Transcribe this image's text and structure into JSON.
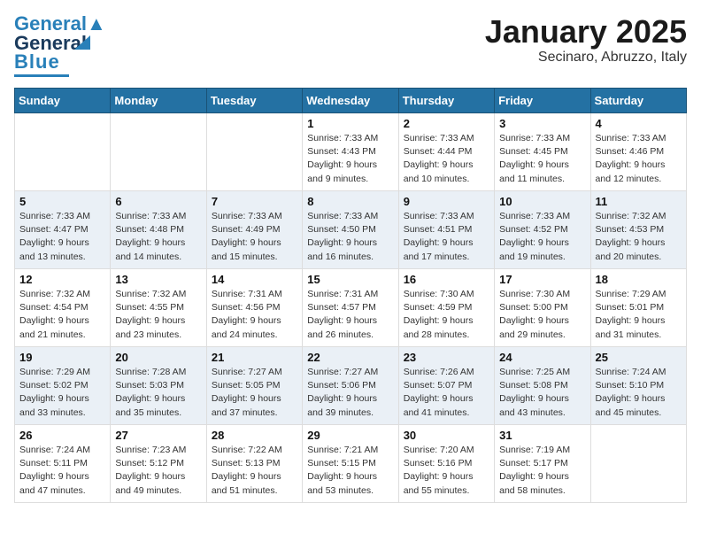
{
  "header": {
    "logo_line1": "General",
    "logo_line2": "Blue",
    "title": "January 2025",
    "subtitle": "Secinaro, Abruzzo, Italy"
  },
  "weekdays": [
    "Sunday",
    "Monday",
    "Tuesday",
    "Wednesday",
    "Thursday",
    "Friday",
    "Saturday"
  ],
  "weeks": [
    [
      {
        "day": "",
        "info": ""
      },
      {
        "day": "",
        "info": ""
      },
      {
        "day": "",
        "info": ""
      },
      {
        "day": "1",
        "info": "Sunrise: 7:33 AM\nSunset: 4:43 PM\nDaylight: 9 hours\nand 9 minutes."
      },
      {
        "day": "2",
        "info": "Sunrise: 7:33 AM\nSunset: 4:44 PM\nDaylight: 9 hours\nand 10 minutes."
      },
      {
        "day": "3",
        "info": "Sunrise: 7:33 AM\nSunset: 4:45 PM\nDaylight: 9 hours\nand 11 minutes."
      },
      {
        "day": "4",
        "info": "Sunrise: 7:33 AM\nSunset: 4:46 PM\nDaylight: 9 hours\nand 12 minutes."
      }
    ],
    [
      {
        "day": "5",
        "info": "Sunrise: 7:33 AM\nSunset: 4:47 PM\nDaylight: 9 hours\nand 13 minutes."
      },
      {
        "day": "6",
        "info": "Sunrise: 7:33 AM\nSunset: 4:48 PM\nDaylight: 9 hours\nand 14 minutes."
      },
      {
        "day": "7",
        "info": "Sunrise: 7:33 AM\nSunset: 4:49 PM\nDaylight: 9 hours\nand 15 minutes."
      },
      {
        "day": "8",
        "info": "Sunrise: 7:33 AM\nSunset: 4:50 PM\nDaylight: 9 hours\nand 16 minutes."
      },
      {
        "day": "9",
        "info": "Sunrise: 7:33 AM\nSunset: 4:51 PM\nDaylight: 9 hours\nand 17 minutes."
      },
      {
        "day": "10",
        "info": "Sunrise: 7:33 AM\nSunset: 4:52 PM\nDaylight: 9 hours\nand 19 minutes."
      },
      {
        "day": "11",
        "info": "Sunrise: 7:32 AM\nSunset: 4:53 PM\nDaylight: 9 hours\nand 20 minutes."
      }
    ],
    [
      {
        "day": "12",
        "info": "Sunrise: 7:32 AM\nSunset: 4:54 PM\nDaylight: 9 hours\nand 21 minutes."
      },
      {
        "day": "13",
        "info": "Sunrise: 7:32 AM\nSunset: 4:55 PM\nDaylight: 9 hours\nand 23 minutes."
      },
      {
        "day": "14",
        "info": "Sunrise: 7:31 AM\nSunset: 4:56 PM\nDaylight: 9 hours\nand 24 minutes."
      },
      {
        "day": "15",
        "info": "Sunrise: 7:31 AM\nSunset: 4:57 PM\nDaylight: 9 hours\nand 26 minutes."
      },
      {
        "day": "16",
        "info": "Sunrise: 7:30 AM\nSunset: 4:59 PM\nDaylight: 9 hours\nand 28 minutes."
      },
      {
        "day": "17",
        "info": "Sunrise: 7:30 AM\nSunset: 5:00 PM\nDaylight: 9 hours\nand 29 minutes."
      },
      {
        "day": "18",
        "info": "Sunrise: 7:29 AM\nSunset: 5:01 PM\nDaylight: 9 hours\nand 31 minutes."
      }
    ],
    [
      {
        "day": "19",
        "info": "Sunrise: 7:29 AM\nSunset: 5:02 PM\nDaylight: 9 hours\nand 33 minutes."
      },
      {
        "day": "20",
        "info": "Sunrise: 7:28 AM\nSunset: 5:03 PM\nDaylight: 9 hours\nand 35 minutes."
      },
      {
        "day": "21",
        "info": "Sunrise: 7:27 AM\nSunset: 5:05 PM\nDaylight: 9 hours\nand 37 minutes."
      },
      {
        "day": "22",
        "info": "Sunrise: 7:27 AM\nSunset: 5:06 PM\nDaylight: 9 hours\nand 39 minutes."
      },
      {
        "day": "23",
        "info": "Sunrise: 7:26 AM\nSunset: 5:07 PM\nDaylight: 9 hours\nand 41 minutes."
      },
      {
        "day": "24",
        "info": "Sunrise: 7:25 AM\nSunset: 5:08 PM\nDaylight: 9 hours\nand 43 minutes."
      },
      {
        "day": "25",
        "info": "Sunrise: 7:24 AM\nSunset: 5:10 PM\nDaylight: 9 hours\nand 45 minutes."
      }
    ],
    [
      {
        "day": "26",
        "info": "Sunrise: 7:24 AM\nSunset: 5:11 PM\nDaylight: 9 hours\nand 47 minutes."
      },
      {
        "day": "27",
        "info": "Sunrise: 7:23 AM\nSunset: 5:12 PM\nDaylight: 9 hours\nand 49 minutes."
      },
      {
        "day": "28",
        "info": "Sunrise: 7:22 AM\nSunset: 5:13 PM\nDaylight: 9 hours\nand 51 minutes."
      },
      {
        "day": "29",
        "info": "Sunrise: 7:21 AM\nSunset: 5:15 PM\nDaylight: 9 hours\nand 53 minutes."
      },
      {
        "day": "30",
        "info": "Sunrise: 7:20 AM\nSunset: 5:16 PM\nDaylight: 9 hours\nand 55 minutes."
      },
      {
        "day": "31",
        "info": "Sunrise: 7:19 AM\nSunset: 5:17 PM\nDaylight: 9 hours\nand 58 minutes."
      },
      {
        "day": "",
        "info": ""
      }
    ]
  ]
}
